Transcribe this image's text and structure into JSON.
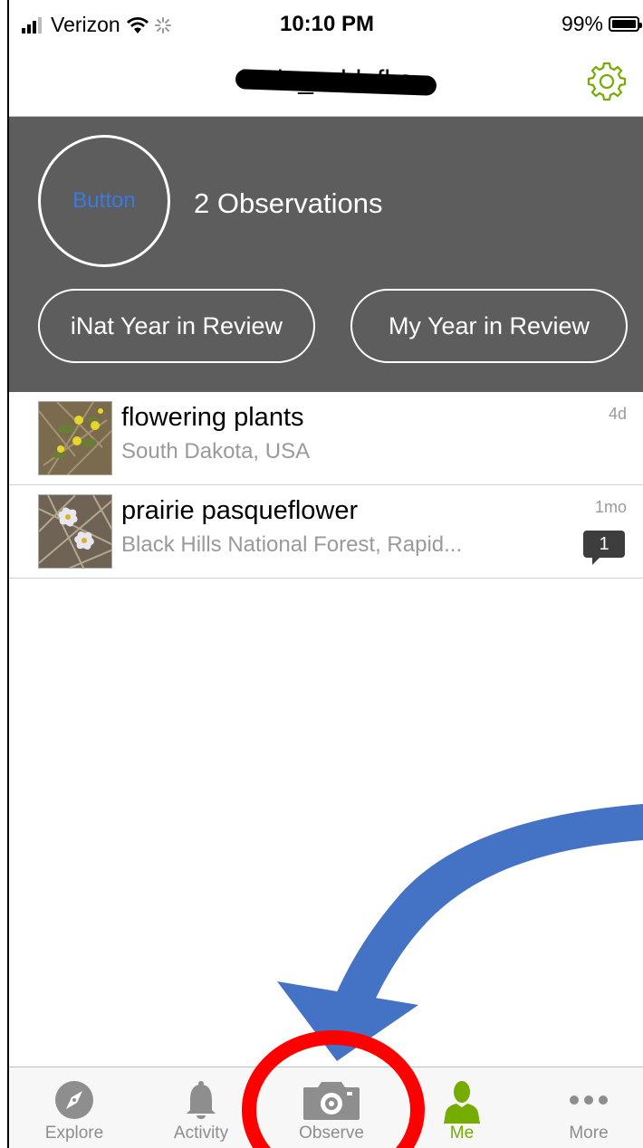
{
  "status_bar": {
    "carrier": "Verizon",
    "time": "10:10 PM",
    "battery": "99%"
  },
  "nav": {
    "title": "katie_schlafke",
    "settings_icon": "gear-icon"
  },
  "profile": {
    "avatar_button_label": "Button",
    "observations_count": "2 Observations",
    "btn_inat_year": "iNat Year in Review",
    "btn_my_year": "My Year in Review"
  },
  "observations": [
    {
      "title": "flowering plants",
      "place": "South Dakota, USA",
      "ago": "4d"
    },
    {
      "title": "prairie pasqueflower",
      "place": "Black Hills National Forest, Rapid...",
      "ago": "1mo",
      "comments": "1"
    }
  ],
  "tabs": [
    {
      "label": "Explore",
      "icon": "compass-icon"
    },
    {
      "label": "Activity",
      "icon": "bell-icon"
    },
    {
      "label": "Observe",
      "icon": "camera-icon"
    },
    {
      "label": "Me",
      "icon": "person-icon",
      "active": true
    },
    {
      "label": "More",
      "icon": "more-dots-icon"
    }
  ],
  "colors": {
    "accent": "#74ac00",
    "header_bg": "#5d5d5d",
    "annotation_arrow": "#4472c4",
    "annotation_circle": "#ff0000"
  }
}
